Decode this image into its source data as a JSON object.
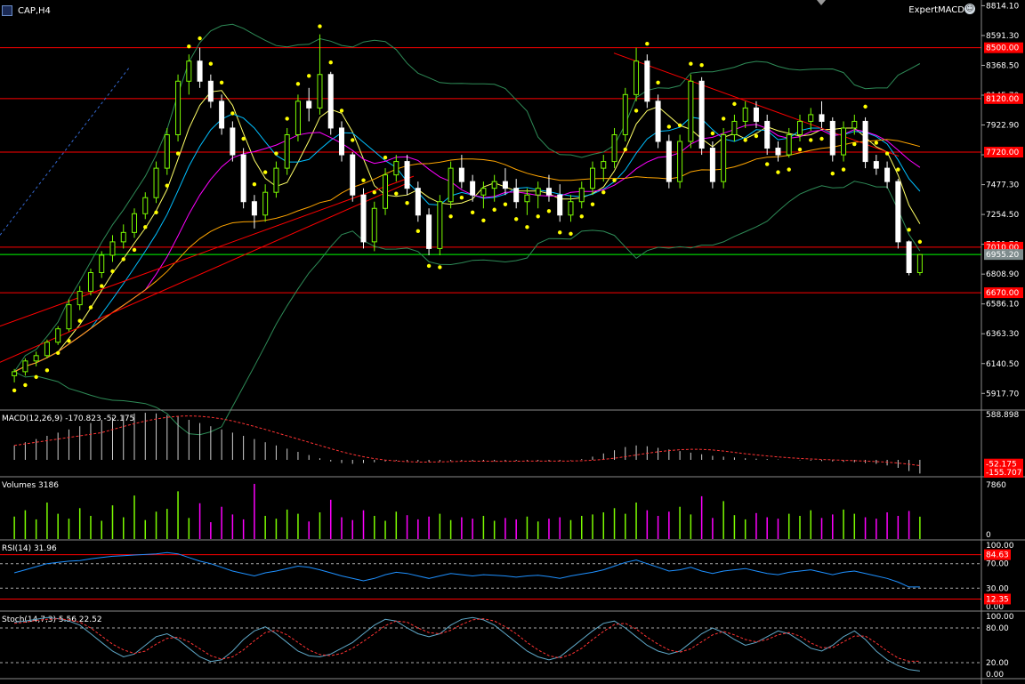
{
  "chart_title": "CAP,H4",
  "expert_label": "ExpertMACD",
  "expert_icon": "smiley-face-icon",
  "colors": {
    "bull": "#7cfc00",
    "bear": "#ffffff",
    "level": "#ff0000",
    "bid": "#00ff00",
    "sar": "#ffff00",
    "bands": "#2e8b57",
    "ma_fast": "#ffff66",
    "ma_mid": "#00bfff",
    "ma_slow": "#ff00ff",
    "ma_long": "#ffa500",
    "rsi": "#1e90ff",
    "signal": "#ff3333"
  },
  "price_axis": [
    "8814.10",
    "8591.30",
    "8368.50",
    "8145.70",
    "7922.90",
    "7700.10",
    "7477.30",
    "7254.50",
    "7031.70",
    "6808.90",
    "6586.10",
    "6363.30",
    "6140.50",
    "5917.70"
  ],
  "price_levels": [
    {
      "price": 8500,
      "label": "8500.00"
    },
    {
      "price": 8120,
      "label": "8120.00"
    },
    {
      "price": 7720,
      "label": "7720.00"
    },
    {
      "price": 7010,
      "label": "7010.00"
    },
    {
      "price": 6670,
      "label": "6670.00"
    }
  ],
  "bid": {
    "price": 6955.2,
    "label": "6955.20"
  },
  "macd": {
    "title": "MACD(12,26,9) -170.823 -52.175",
    "axis": [
      "588.898"
    ],
    "tags": [
      "-52.175",
      "-155.707"
    ]
  },
  "volumes": {
    "title": "Volumes 3186",
    "axis": [
      "7860",
      "0"
    ]
  },
  "rsi": {
    "title": "RSI(14) 31.96",
    "axis": [
      "100.00",
      "70.00",
      "30.00",
      "0.00"
    ],
    "tags": [
      "84.63",
      "12.35"
    ]
  },
  "stoch": {
    "title": "Stoch(14,7,3) 5.56 22.52",
    "axis": [
      "100.00",
      "80.00",
      "20.00",
      "0.00"
    ]
  },
  "chart_data": {
    "type": "candlestick",
    "title": "CAP,H4",
    "ylim": [
      5800,
      8830
    ],
    "candles": [
      [
        6050,
        6100,
        6000,
        6080
      ],
      [
        6080,
        6180,
        6050,
        6160
      ],
      [
        6160,
        6230,
        6120,
        6200
      ],
      [
        6200,
        6320,
        6180,
        6300
      ],
      [
        6300,
        6420,
        6280,
        6400
      ],
      [
        6400,
        6620,
        6380,
        6580
      ],
      [
        6580,
        6720,
        6540,
        6680
      ],
      [
        6680,
        6850,
        6650,
        6820
      ],
      [
        6820,
        6980,
        6780,
        6950
      ],
      [
        6950,
        7100,
        6900,
        7050
      ],
      [
        7050,
        7180,
        7000,
        7120
      ],
      [
        7120,
        7300,
        7080,
        7260
      ],
      [
        7260,
        7420,
        7220,
        7380
      ],
      [
        7380,
        7650,
        7340,
        7600
      ],
      [
        7600,
        7900,
        7550,
        7850
      ],
      [
        7850,
        8300,
        7800,
        8250
      ],
      [
        8250,
        8450,
        8150,
        8400
      ],
      [
        8400,
        8500,
        8200,
        8250
      ],
      [
        8250,
        8300,
        8050,
        8100
      ],
      [
        8100,
        8150,
        7850,
        7900
      ],
      [
        7900,
        7950,
        7650,
        7700
      ],
      [
        7700,
        7750,
        7300,
        7350
      ],
      [
        7350,
        7400,
        7150,
        7250
      ],
      [
        7250,
        7480,
        7200,
        7420
      ],
      [
        7420,
        7650,
        7380,
        7600
      ],
      [
        7600,
        7900,
        7550,
        7850
      ],
      [
        7850,
        8150,
        7800,
        8100
      ],
      [
        8100,
        8200,
        7950,
        8050
      ],
      [
        8050,
        8600,
        8000,
        8300
      ],
      [
        8300,
        8320,
        7850,
        7900
      ],
      [
        7900,
        7950,
        7650,
        7700
      ],
      [
        7700,
        7720,
        7350,
        7400
      ],
      [
        7400,
        7450,
        7000,
        7050
      ],
      [
        7050,
        7350,
        6980,
        7300
      ],
      [
        7300,
        7600,
        7250,
        7550
      ],
      [
        7550,
        7700,
        7500,
        7650
      ],
      [
        7650,
        7700,
        7400,
        7450
      ],
      [
        7450,
        7500,
        7200,
        7250
      ],
      [
        7250,
        7300,
        6950,
        7000
      ],
      [
        7000,
        7400,
        6950,
        7350
      ],
      [
        7350,
        7650,
        7300,
        7600
      ],
      [
        7600,
        7700,
        7450,
        7500
      ],
      [
        7500,
        7550,
        7350,
        7400
      ],
      [
        7400,
        7500,
        7300,
        7450
      ],
      [
        7450,
        7550,
        7350,
        7500
      ],
      [
        7500,
        7600,
        7400,
        7450
      ],
      [
        7450,
        7520,
        7300,
        7350
      ],
      [
        7350,
        7450,
        7250,
        7400
      ],
      [
        7400,
        7500,
        7300,
        7450
      ],
      [
        7450,
        7550,
        7350,
        7400
      ],
      [
        7400,
        7480,
        7200,
        7250
      ],
      [
        7250,
        7400,
        7200,
        7350
      ],
      [
        7350,
        7500,
        7300,
        7450
      ],
      [
        7450,
        7650,
        7400,
        7600
      ],
      [
        7600,
        7700,
        7500,
        7650
      ],
      [
        7650,
        7900,
        7600,
        7850
      ],
      [
        7850,
        8200,
        7800,
        8150
      ],
      [
        8150,
        8500,
        8100,
        8400
      ],
      [
        8400,
        8450,
        8050,
        8100
      ],
      [
        8100,
        8150,
        7750,
        7800
      ],
      [
        7800,
        7850,
        7450,
        7500
      ],
      [
        7500,
        7850,
        7450,
        7800
      ],
      [
        7800,
        8300,
        7750,
        8250
      ],
      [
        8250,
        8280,
        7700,
        7750
      ],
      [
        7750,
        7800,
        7450,
        7500
      ],
      [
        7500,
        7900,
        7450,
        7850
      ],
      [
        7850,
        8000,
        7800,
        7950
      ],
      [
        7950,
        8100,
        7900,
        8050
      ],
      [
        8050,
        8100,
        7900,
        7950
      ],
      [
        7950,
        8000,
        7700,
        7750
      ],
      [
        7750,
        7800,
        7650,
        7700
      ],
      [
        7700,
        7900,
        7680,
        7850
      ],
      [
        7850,
        8000,
        7800,
        7950
      ],
      [
        7950,
        8050,
        7880,
        8000
      ],
      [
        8000,
        8100,
        7900,
        7950
      ],
      [
        7950,
        7980,
        7650,
        7700
      ],
      [
        7700,
        7950,
        7650,
        7900
      ],
      [
        7900,
        8000,
        7850,
        7950
      ],
      [
        7950,
        7980,
        7600,
        7650
      ],
      [
        7650,
        7700,
        7550,
        7600
      ],
      [
        7600,
        7650,
        7450,
        7500
      ],
      [
        7500,
        7520,
        7000,
        7050
      ],
      [
        7050,
        7060,
        6800,
        6820
      ],
      [
        6820,
        6960,
        6800,
        6955
      ]
    ],
    "rsi": [
      55,
      60,
      65,
      70,
      72,
      74,
      75,
      78,
      80,
      82,
      83,
      84,
      85,
      86,
      88,
      86,
      80,
      74,
      70,
      64,
      58,
      54,
      50,
      55,
      58,
      62,
      66,
      64,
      60,
      55,
      50,
      46,
      42,
      46,
      52,
      56,
      54,
      50,
      46,
      50,
      54,
      52,
      50,
      52,
      51,
      50,
      48,
      50,
      51,
      49,
      46,
      50,
      53,
      56,
      60,
      66,
      72,
      76,
      70,
      64,
      58,
      60,
      64,
      58,
      54,
      58,
      60,
      62,
      58,
      54,
      52,
      56,
      58,
      60,
      56,
      52,
      56,
      58,
      54,
      50,
      46,
      40,
      32,
      32
    ],
    "stoch_k": [
      90,
      92,
      95,
      98,
      96,
      92,
      85,
      70,
      55,
      40,
      30,
      35,
      50,
      65,
      70,
      60,
      45,
      30,
      22,
      25,
      40,
      60,
      75,
      82,
      70,
      55,
      40,
      32,
      30,
      35,
      45,
      55,
      70,
      85,
      95,
      92,
      80,
      70,
      65,
      70,
      85,
      95,
      98,
      94,
      85,
      70,
      55,
      40,
      30,
      25,
      30,
      45,
      60,
      75,
      88,
      92,
      80,
      65,
      50,
      40,
      35,
      40,
      55,
      70,
      80,
      72,
      60,
      50,
      55,
      65,
      75,
      70,
      58,
      45,
      40,
      50,
      65,
      75,
      60,
      40,
      25,
      15,
      8,
      5.56
    ],
    "stoch_d": [
      88,
      90,
      93,
      95,
      96,
      94,
      90,
      80,
      66,
      52,
      42,
      36,
      40,
      52,
      62,
      64,
      56,
      44,
      32,
      26,
      30,
      42,
      58,
      72,
      76,
      68,
      55,
      42,
      34,
      32,
      36,
      45,
      57,
      70,
      84,
      92,
      90,
      80,
      72,
      70,
      76,
      86,
      94,
      96,
      92,
      82,
      70,
      55,
      42,
      32,
      28,
      34,
      45,
      60,
      74,
      86,
      88,
      78,
      64,
      52,
      42,
      38,
      44,
      56,
      68,
      74,
      68,
      60,
      56,
      60,
      68,
      72,
      66,
      54,
      46,
      46,
      56,
      66,
      66,
      54,
      40,
      28,
      22.52,
      22.52
    ],
    "volumes": [
      3200,
      4100,
      2800,
      5200,
      3600,
      2900,
      4400,
      3300,
      2600,
      4800,
      3100,
      6200,
      2700,
      3900,
      4300,
      6800,
      3000,
      5100,
      2400,
      4600,
      3500,
      2800,
      7860,
      3300,
      2900,
      4200,
      3600,
      2500,
      3800,
      5600,
      3100,
      2700,
      4100,
      3300,
      2600,
      3900,
      3400,
      2800,
      3200,
      3600,
      2700,
      3100,
      2900,
      3300,
      2600,
      3000,
      2800,
      3200,
      2500,
      2900,
      3100,
      2700,
      3300,
      3500,
      3800,
      4400,
      3600,
      5200,
      4100,
      3300,
      3900,
      4600,
      3500,
      6100,
      3000,
      5400,
      3400,
      2800,
      3700,
      3100,
      2900,
      3600,
      3300,
      4100,
      3000,
      3500,
      4200,
      3600,
      3100,
      2900,
      3800,
      3300,
      4000,
      3186
    ],
    "macd": [
      180,
      220,
      260,
      300,
      340,
      380,
      420,
      460,
      500,
      530,
      560,
      580,
      588,
      580,
      560,
      540,
      500,
      460,
      420,
      380,
      340,
      300,
      260,
      220,
      180,
      140,
      100,
      60,
      20,
      -20,
      -40,
      -50,
      -40,
      -30,
      -20,
      -10,
      -15,
      -20,
      -25,
      -20,
      -15,
      -10,
      -15,
      -20,
      -18,
      -15,
      -12,
      -10,
      -15,
      -20,
      -15,
      -5,
      10,
      40,
      80,
      120,
      160,
      180,
      170,
      150,
      130,
      110,
      90,
      70,
      50,
      40,
      30,
      20,
      15,
      10,
      5,
      0,
      -5,
      -10,
      -15,
      -20,
      -25,
      -30,
      -40,
      -50,
      -70,
      -100,
      -140,
      -170.823
    ]
  }
}
